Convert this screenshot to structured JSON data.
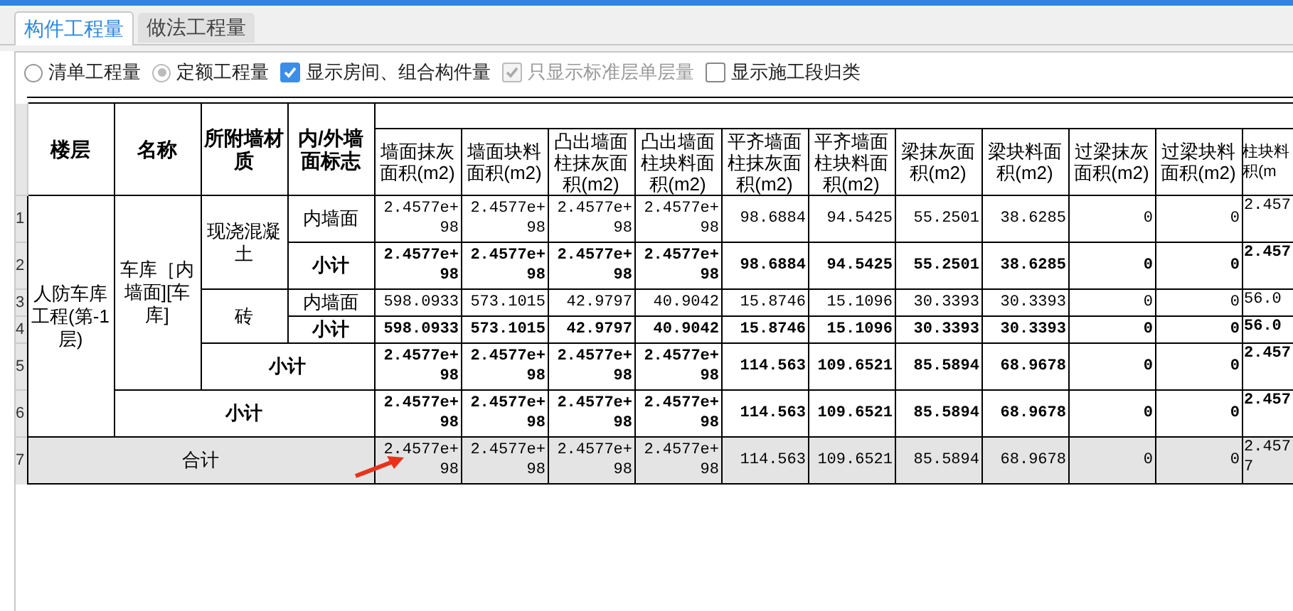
{
  "tabs": [
    {
      "label": "构件工程量",
      "selected": true
    },
    {
      "label": "做法工程量",
      "selected": false
    }
  ],
  "options": [
    {
      "kind": "radio",
      "label": "清单工程量",
      "checked": false,
      "disabled": false
    },
    {
      "kind": "radio",
      "label": "定额工程量",
      "checked": true,
      "disabled": true
    },
    {
      "kind": "checkbox",
      "label": "显示房间、组合构件量",
      "checked": true,
      "disabled": false
    },
    {
      "kind": "checkbox",
      "label": "只显示标准层单层量",
      "checked": true,
      "disabled": true
    },
    {
      "kind": "checkbox",
      "label": "显示施工段归类",
      "checked": false,
      "disabled": false
    }
  ],
  "table": {
    "label_columns": [
      "楼层",
      "名称",
      "所附墙材质",
      "内/外墙面标志"
    ],
    "columns": [
      "墙面抹灰面积(m2)",
      "墙面块料面积(m2)",
      "凸出墙面柱抹灰面积(m2)",
      "凸出墙面柱块料面积(m2)",
      "平齐墙面柱抹灰面积(m2)",
      "平齐墙面柱块料面积(m2)",
      "梁抹灰面积(m2)",
      "梁块料面积(m2)",
      "过梁抹灰面积(m2)",
      "过梁块料面积(m2)"
    ],
    "column_11": [
      "柱块料",
      "积(m"
    ],
    "rows": [
      {
        "number": "1",
        "kind": "detail",
        "labels": [
          {
            "text": "人防车库工程(第-1层)",
            "rowspan": 6
          },
          {
            "text": "车库［内墙面][车库]",
            "rowspan": 5
          },
          {
            "text": "现浇混凝土",
            "rowspan": 2
          },
          {
            "text": "内墙面"
          }
        ],
        "values": [
          "2.4577e+98",
          "2.4577e+98",
          "2.4577e+98",
          "2.4577e+98",
          "98.6884",
          "94.5425",
          "55.2501",
          "38.6285",
          "0",
          "0",
          "2.457"
        ]
      },
      {
        "number": "2",
        "kind": "subtotal",
        "labels": [
          {
            "text": "小计"
          }
        ],
        "values": [
          "2.4577e+98",
          "2.4577e+98",
          "2.4577e+98",
          "2.4577e+98",
          "98.6884",
          "94.5425",
          "55.2501",
          "38.6285",
          "0",
          "0",
          "2.457"
        ]
      },
      {
        "number": "3",
        "kind": "detail",
        "labels": [
          {
            "text": "砖",
            "rowspan": 2
          },
          {
            "text": "内墙面"
          }
        ],
        "values": [
          "598.0933",
          "573.1015",
          "42.9797",
          "40.9042",
          "15.8746",
          "15.1096",
          "30.3393",
          "30.3393",
          "0",
          "0",
          "56.0"
        ]
      },
      {
        "number": "4",
        "kind": "subtotal",
        "labels": [
          {
            "text": "小计"
          }
        ],
        "values": [
          "598.0933",
          "573.1015",
          "42.9797",
          "40.9042",
          "15.8746",
          "15.1096",
          "30.3393",
          "30.3393",
          "0",
          "0",
          "56.0"
        ]
      },
      {
        "number": "5",
        "kind": "subtotal",
        "labels": [
          {
            "text": "小计",
            "colspan": 2
          }
        ],
        "values": [
          "2.4577e+98",
          "2.4577e+98",
          "2.4577e+98",
          "2.4577e+98",
          "114.563",
          "109.6521",
          "85.5894",
          "68.9678",
          "0",
          "0",
          "2.457"
        ]
      },
      {
        "number": "6",
        "kind": "subtotal",
        "labels": [
          {
            "text": "小计",
            "colspan": 3
          }
        ],
        "values": [
          "2.4577e+98",
          "2.4577e+98",
          "2.4577e+98",
          "2.4577e+98",
          "114.563",
          "109.6521",
          "85.5894",
          "68.9678",
          "0",
          "0",
          "2.457"
        ]
      },
      {
        "number": "7",
        "kind": "total",
        "labels": [
          {
            "text": "合计",
            "colspan": 4
          }
        ],
        "values": [
          "2.4577e+98",
          "2.4577e+98",
          "2.4577e+98",
          "2.4577e+98",
          "114.563",
          "109.6521",
          "85.5894",
          "68.9678",
          "0",
          "0",
          "2.4577"
        ]
      }
    ]
  }
}
